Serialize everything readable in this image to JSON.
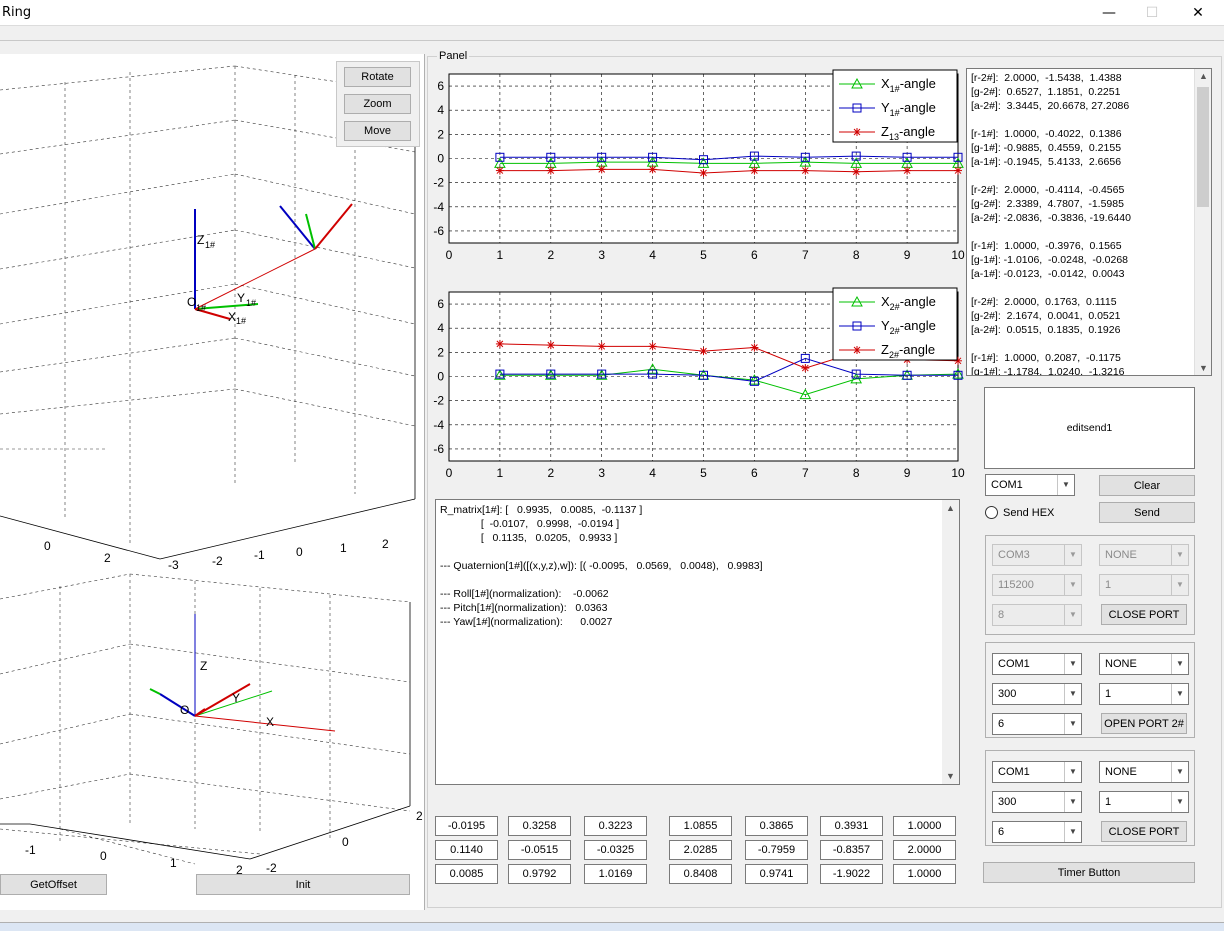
{
  "window": {
    "title": "Ring",
    "minimize": "—",
    "maximize": "☐",
    "close": "✕"
  },
  "panel_label": "Panel",
  "view_buttons": {
    "rotate": "Rotate",
    "zoom": "Zoom",
    "move": "Move"
  },
  "bottom_buttons": {
    "get_offset": "GetOffset",
    "init": "Init"
  },
  "axes3d_top": {
    "x_ticks": [
      "0",
      "2"
    ],
    "y_ticks": [
      "-3",
      "-2",
      "-1",
      "0",
      "1",
      "2"
    ],
    "labels": {
      "z": "Z",
      "y": "Y",
      "x": "X",
      "o": "O",
      "sub": "1#"
    }
  },
  "axes3d_bottom": {
    "x_ticks": [
      "-1",
      "0",
      "1",
      "2"
    ],
    "y_ticks": [
      "-2",
      "0",
      "2"
    ],
    "labels": {
      "z": "Z",
      "y": "Y",
      "x": "X",
      "o": "O"
    }
  },
  "chart_data": [
    {
      "type": "line",
      "x": [
        1,
        2,
        3,
        4,
        5,
        6,
        7,
        8,
        9,
        10
      ],
      "xlim": [
        0,
        10
      ],
      "ylim": [
        -7,
        7
      ],
      "xticks": [
        "0",
        "1",
        "2",
        "3",
        "4",
        "5",
        "6",
        "7",
        "8",
        "9",
        "10"
      ],
      "yticks": [
        "6",
        "4",
        "2",
        "0",
        "-2",
        "-4",
        "-6"
      ],
      "grid": true,
      "legend_position": "top-right",
      "series": [
        {
          "name": "X1#-angle",
          "label_main": "X",
          "label_sub": "1#",
          "label_tail": "-angle",
          "color": "#00c000",
          "marker": "triangle",
          "values": [
            -0.4,
            -0.4,
            -0.3,
            -0.3,
            -0.4,
            -0.4,
            -0.3,
            -0.4,
            -0.4,
            -0.4
          ]
        },
        {
          "name": "Y1#-angle",
          "label_main": "Y",
          "label_sub": "1#",
          "label_tail": "-angle",
          "color": "#0000c0",
          "marker": "square",
          "values": [
            0.1,
            0.1,
            0.1,
            0.1,
            -0.1,
            0.2,
            0.1,
            0.2,
            0.1,
            0.1
          ]
        },
        {
          "name": "Z13-angle",
          "label_main": "Z",
          "label_sub": "13",
          "label_tail": "-angle",
          "color": "#d00000",
          "marker": "star",
          "values": [
            -1.0,
            -1.0,
            -0.9,
            -0.9,
            -1.2,
            -1.0,
            -1.0,
            -1.1,
            -1.0,
            -1.0
          ]
        }
      ]
    },
    {
      "type": "line",
      "x": [
        1,
        2,
        3,
        4,
        5,
        6,
        7,
        8,
        9,
        10
      ],
      "xlim": [
        0,
        10
      ],
      "ylim": [
        -7,
        7
      ],
      "xticks": [
        "0",
        "1",
        "2",
        "3",
        "4",
        "5",
        "6",
        "7",
        "8",
        "9",
        "10"
      ],
      "yticks": [
        "6",
        "4",
        "2",
        "0",
        "-2",
        "-4",
        "-6"
      ],
      "grid": true,
      "legend_position": "top-right",
      "series": [
        {
          "name": "X2#-angle",
          "label_main": "X",
          "label_sub": "2#",
          "label_tail": "-angle",
          "color": "#00c000",
          "marker": "triangle",
          "values": [
            0.1,
            0.1,
            0.1,
            0.6,
            0.1,
            -0.3,
            -1.5,
            -0.2,
            0.1,
            0.2
          ]
        },
        {
          "name": "Y2#-angle",
          "label_main": "Y",
          "label_sub": "2#",
          "label_tail": "-angle",
          "color": "#0000c0",
          "marker": "square",
          "values": [
            0.2,
            0.2,
            0.2,
            0.2,
            0.1,
            -0.4,
            1.5,
            0.2,
            0.1,
            0.1
          ]
        },
        {
          "name": "Z2#-angle",
          "label_main": "Z",
          "label_sub": "2#",
          "label_tail": "-angle",
          "color": "#d00000",
          "marker": "star",
          "values": [
            2.7,
            2.6,
            2.5,
            2.5,
            2.1,
            2.4,
            0.7,
            2.0,
            1.4,
            1.3
          ]
        }
      ]
    }
  ],
  "log_lines": [
    "[r-2#]:  2.0000,  -1.5438,  1.4388",
    "[g-2#]:  0.6527,  1.1851,  0.2251",
    "[a-2#]:  3.3445,  20.6678, 27.2086",
    "",
    "[r-1#]:  1.0000,  -0.4022,  0.1386",
    "[g-1#]: -0.9885,  0.4559,  0.2155",
    "[a-1#]: -0.1945,  5.4133,  2.6656",
    "",
    "[r-2#]:  2.0000,  -0.4114,  -0.4565",
    "[g-2#]:  2.3389,  4.7807,  -1.5985",
    "[a-2#]: -2.0836,  -0.3836, -19.6440",
    "",
    "[r-1#]:  1.0000,  -0.3976,  0.1565",
    "[g-1#]: -1.0106,  -0.0248,  -0.0268",
    "[a-1#]: -0.0123,  -0.0142,  0.0043",
    "",
    "[r-2#]:  2.0000,  0.1763,  0.1115",
    "[g-2#]:  2.1674,  0.0041,  0.0521",
    "[a-2#]:  0.0515,  0.1835,  0.1926",
    "",
    "[r-1#]:  1.0000,  0.2087,  -0.1175",
    "[g-1#]: -1.1784,  1.0240,  -1.3216"
  ],
  "matrix_lines": [
    "R_matrix[1#]: [   0.9935,   0.0085,  -0.1137 ]",
    "              [  -0.0107,   0.9998,  -0.0194 ]",
    "              [   0.1135,   0.0205,   0.9933 ]",
    "",
    "--- Quaternion[1#]([(x,y,z),w]): [( -0.0095,   0.0569,   0.0048),   0.9983]",
    "",
    "--- Roll[1#](normalization):    -0.0062",
    "--- Pitch[1#](normalization):   0.0363",
    "--- Yaw[1#](normalization):      0.0027"
  ],
  "value_grid": [
    [
      "-0.0195",
      "0.3258",
      "0.3223",
      "1.0855",
      "0.3865",
      "0.3931",
      "1.0000"
    ],
    [
      "0.1140",
      "-0.0515",
      "-0.0325",
      "2.0285",
      "-0.7959",
      "-0.8357",
      "2.0000"
    ],
    [
      "0.0085",
      "0.9792",
      "1.0169",
      "0.8408",
      "0.9741",
      "-1.9022",
      "1.0000"
    ]
  ],
  "serial": {
    "edit_send": "editsend1",
    "com_select": "COM1",
    "clear": "Clear",
    "send_hex": "Send HEX",
    "send": "Send",
    "timer": "Timer Button",
    "groups": [
      {
        "port": "COM3",
        "parity": "NONE",
        "baud": "115200",
        "stop": "1",
        "data_bits": "8",
        "button": "CLOSE PORT",
        "disabled": true
      },
      {
        "port": "COM1",
        "parity": "NONE",
        "baud": "300",
        "stop": "1",
        "data_bits": "6",
        "button": "OPEN PORT 2#",
        "disabled": false
      },
      {
        "port": "COM1",
        "parity": "NONE",
        "baud": "300",
        "stop": "1",
        "data_bits": "6",
        "button": "CLOSE PORT",
        "disabled": false
      }
    ]
  }
}
